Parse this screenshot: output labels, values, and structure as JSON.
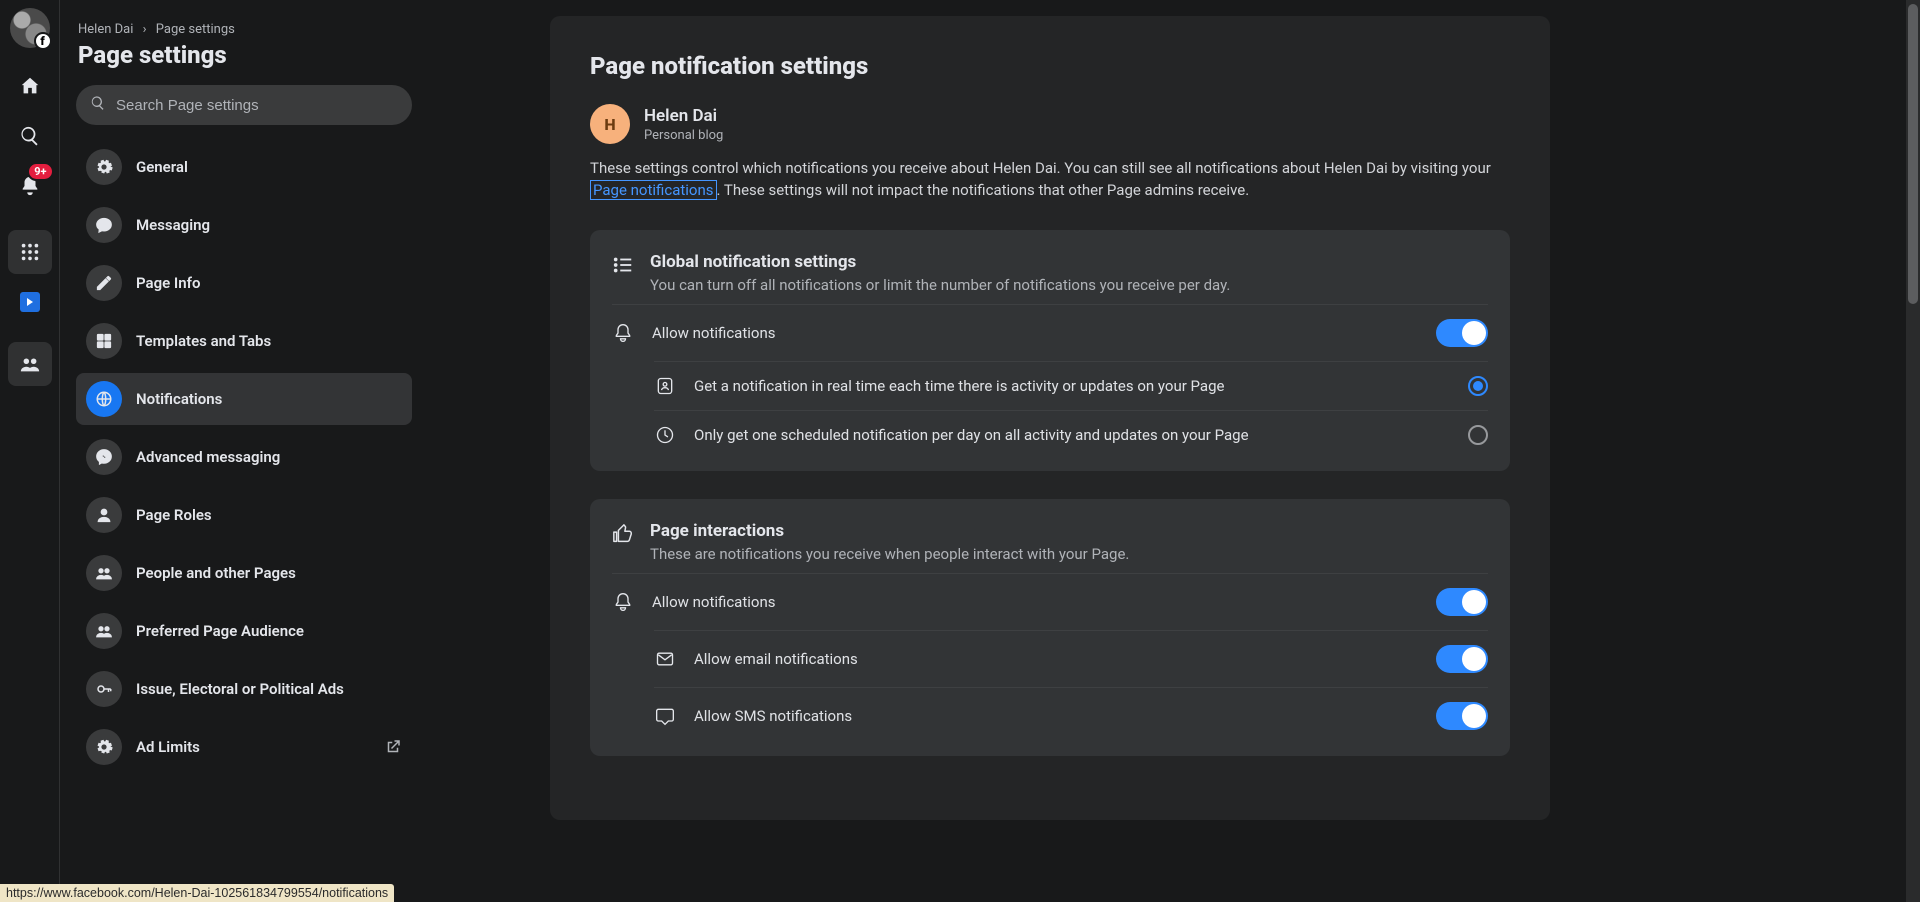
{
  "rail": {
    "notifications_badge": "9+"
  },
  "breadcrumbs": {
    "person": "Helen Dai",
    "separator": "›",
    "current": "Page settings"
  },
  "page_title": "Page settings",
  "search": {
    "placeholder": "Search Page settings"
  },
  "nav": [
    {
      "key": "general",
      "label": "General",
      "icon": "gear"
    },
    {
      "key": "messaging",
      "label": "Messaging",
      "icon": "chat"
    },
    {
      "key": "pageinfo",
      "label": "Page Info",
      "icon": "pencil"
    },
    {
      "key": "templates",
      "label": "Templates and Tabs",
      "icon": "grid4"
    },
    {
      "key": "notifications",
      "label": "Notifications",
      "icon": "globe",
      "active": true
    },
    {
      "key": "advmsg",
      "label": "Advanced messaging",
      "icon": "messenger"
    },
    {
      "key": "roles",
      "label": "Page Roles",
      "icon": "person"
    },
    {
      "key": "people",
      "label": "People and other Pages",
      "icon": "people"
    },
    {
      "key": "audience",
      "label": "Preferred Page Audience",
      "icon": "people"
    },
    {
      "key": "issue",
      "label": "Issue, Electoral or Political Ads",
      "icon": "key"
    },
    {
      "key": "adlimits",
      "label": "Ad Limits",
      "icon": "gear",
      "external": true
    }
  ],
  "main": {
    "heading": "Page notification settings",
    "profile": {
      "initial": "H",
      "name": "Helen Dai",
      "type": "Personal blog"
    },
    "desc": {
      "pre": "These settings control which notifications you receive about Helen Dai. You can still see all notifications about Helen Dai by visiting your ",
      "link": "Page notifications",
      "post": ". These settings will not impact the notifications that other Page admins receive."
    },
    "global_card": {
      "title": "Global notification settings",
      "sub": "You can turn off all notifications or limit the number of notifications you receive per day.",
      "allow_label": "Allow notifications",
      "allow_on": true,
      "opt_realtime": "Get a notification in real time each time there is activity or updates on your Page",
      "opt_daily": "Only get one scheduled notification per day on all activity and updates on your Page",
      "selected": "realtime"
    },
    "interactions_card": {
      "title": "Page interactions",
      "sub": "These are notifications you receive when people interact with your Page.",
      "allow_label": "Allow notifications",
      "allow_on": true,
      "email_label": "Allow email notifications",
      "email_on": true,
      "sms_label": "Allow SMS notifications",
      "sms_on": true
    }
  },
  "status_url": "https://www.facebook.com/Helen-Dai-102561834799554/notifications"
}
